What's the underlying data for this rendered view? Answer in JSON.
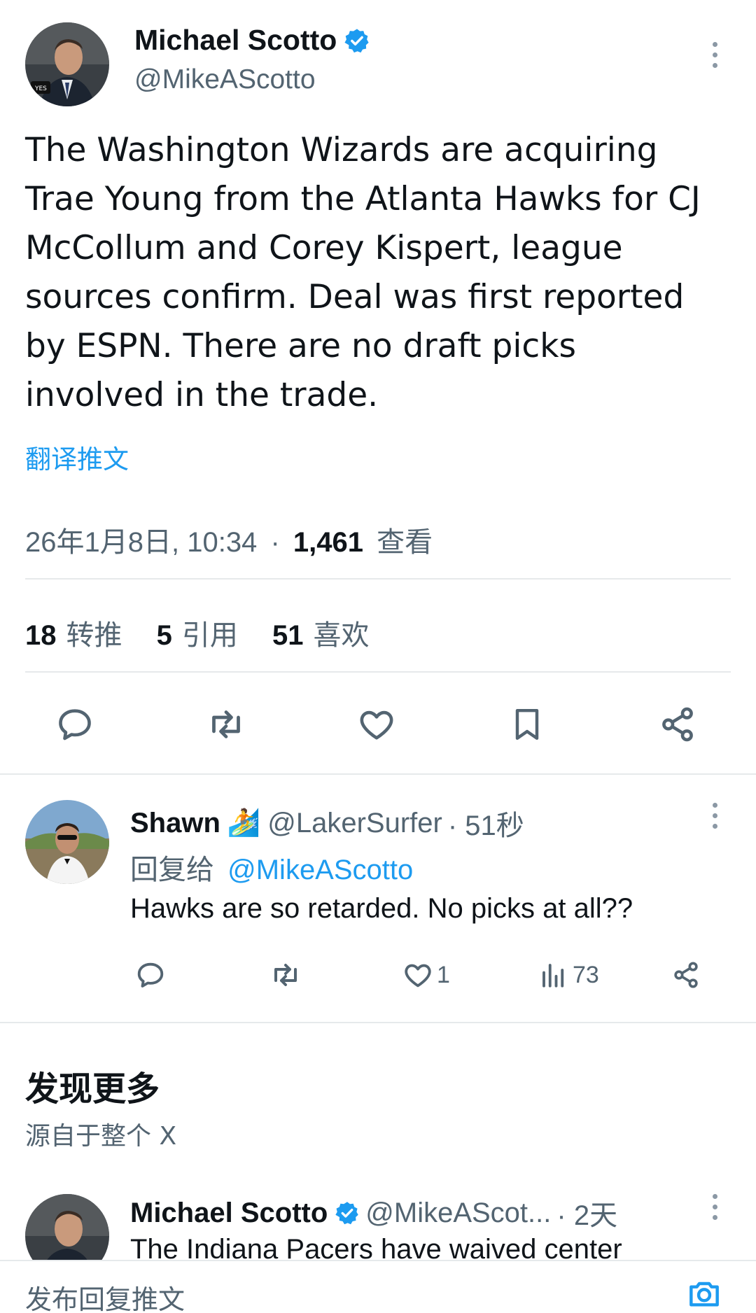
{
  "main_tweet": {
    "author_name": "Michael Scotto",
    "handle": "@MikeAScotto",
    "verified": true,
    "text": "The Washington Wizards are acquiring Trae Young from the Atlanta Hawks for CJ McCollum and Corey Kispert, league sources confirm. Deal was first reported by ESPN. There are no draft picks involved in the trade.",
    "translate_label": "翻译推文",
    "timestamp": "26年1月8日, 10:34",
    "separator": "·",
    "views_count": "1,461",
    "views_label": "查看",
    "stats": [
      {
        "count": "18",
        "label": "转推"
      },
      {
        "count": "5",
        "label": "引用"
      },
      {
        "count": "51",
        "label": "喜欢"
      }
    ],
    "actions": [
      "reply-icon",
      "retweet-icon",
      "like-icon",
      "bookmark-icon",
      "share-icon"
    ]
  },
  "reply": {
    "author_name": "Shawn",
    "emoji": "🏄",
    "handle": "@LakerSurfer",
    "time": "· 51秒",
    "replying_prefix": "回复给",
    "replying_to": "@MikeAScotto",
    "text": "Hawks are so retarded. No picks at all??",
    "like_count": "1",
    "views_count": "73"
  },
  "discover": {
    "title": "发现更多",
    "subtitle": "源自于整个 X"
  },
  "suggested_tweet": {
    "author_name": "Michael Scotto",
    "handle": "@MikeAScot...",
    "time": "· 2天",
    "text": "The Indiana Pacers have waived center"
  },
  "composer": {
    "placeholder": "发布回复推文"
  },
  "colors": {
    "accent": "#1d9bf0",
    "text": "#0f1419",
    "muted": "#536471",
    "divider": "#e6e9eb"
  }
}
